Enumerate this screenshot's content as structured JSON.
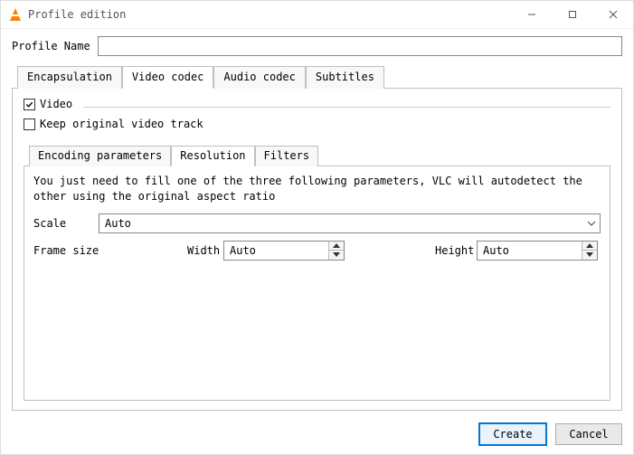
{
  "window": {
    "title": "Profile edition"
  },
  "profile": {
    "label": "Profile Name",
    "value": ""
  },
  "tabs": [
    {
      "label": "Encapsulation",
      "active": false
    },
    {
      "label": "Video codec",
      "active": true
    },
    {
      "label": "Audio codec",
      "active": false
    },
    {
      "label": "Subtitles",
      "active": false
    }
  ],
  "video_codec": {
    "video_checkbox": {
      "label": "Video",
      "checked": true
    },
    "keep_original_checkbox": {
      "label": "Keep original video track",
      "checked": false
    },
    "inner_tabs": [
      {
        "label": "Encoding parameters",
        "active": false
      },
      {
        "label": "Resolution",
        "active": true
      },
      {
        "label": "Filters",
        "active": false
      }
    ],
    "resolution": {
      "help": "You just need to fill one of the three following parameters, VLC will autodetect the other using the original aspect ratio",
      "scale": {
        "label": "Scale",
        "value": "Auto"
      },
      "frame_size_label": "Frame size",
      "width": {
        "label": "Width",
        "value": "Auto"
      },
      "height": {
        "label": "Height",
        "value": "Auto"
      }
    }
  },
  "buttons": {
    "create": "Create",
    "cancel": "Cancel"
  }
}
